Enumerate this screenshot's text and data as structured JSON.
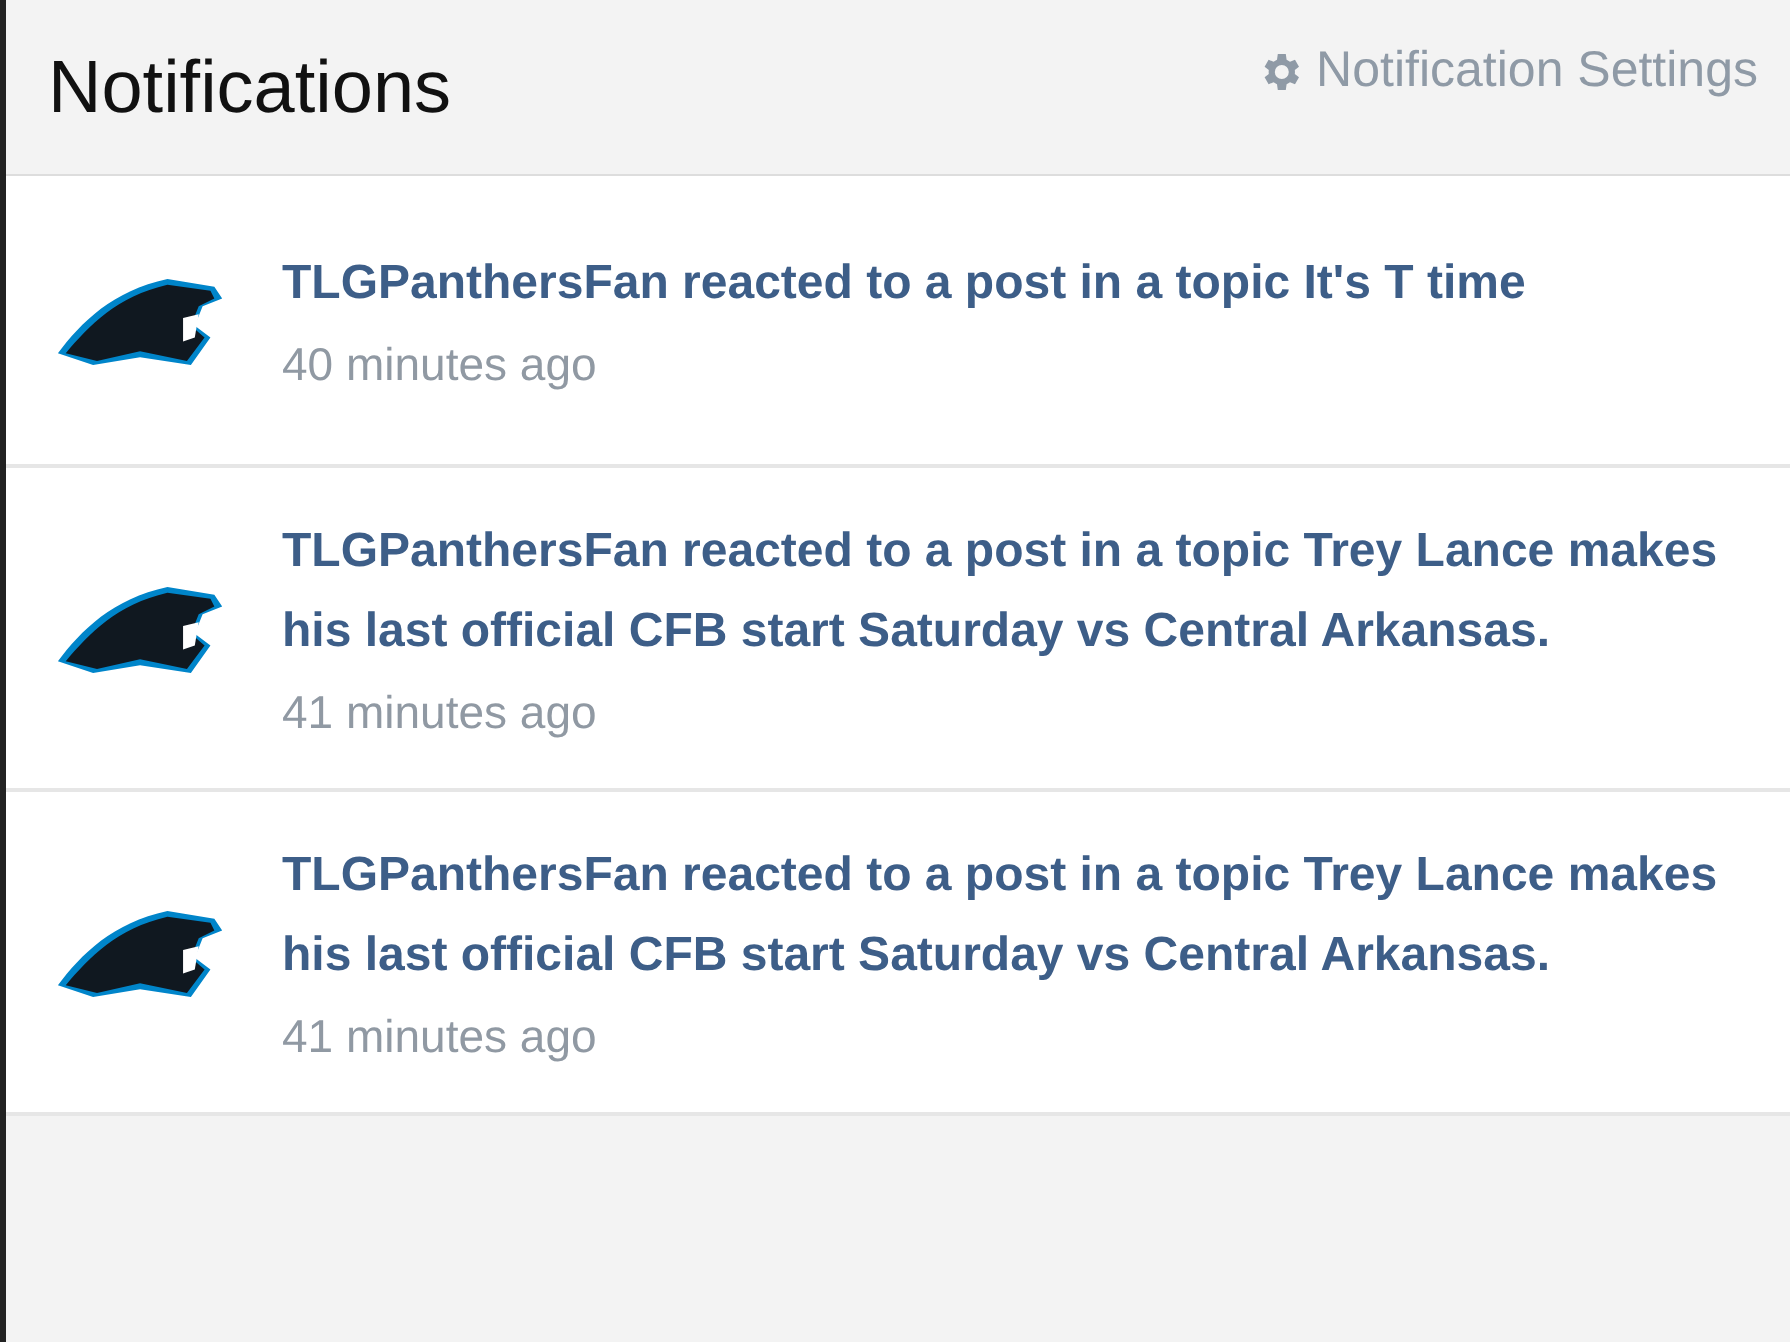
{
  "header": {
    "title": "Notifications",
    "settings_link": "Notification Settings"
  },
  "notifications": [
    {
      "text": "TLGPanthersFan reacted to a post in a topic It's T time",
      "time": "40 minutes ago"
    },
    {
      "text": "TLGPanthersFan reacted to a post in a topic Trey Lance makes his last official CFB start Saturday vs Central Arkansas.",
      "time": "41 minutes ago"
    },
    {
      "text": "TLGPanthersFan reacted to a post in a topic Trey Lance makes his last official CFB start Saturday vs Central Arkansas.",
      "time": "41 minutes ago"
    }
  ]
}
